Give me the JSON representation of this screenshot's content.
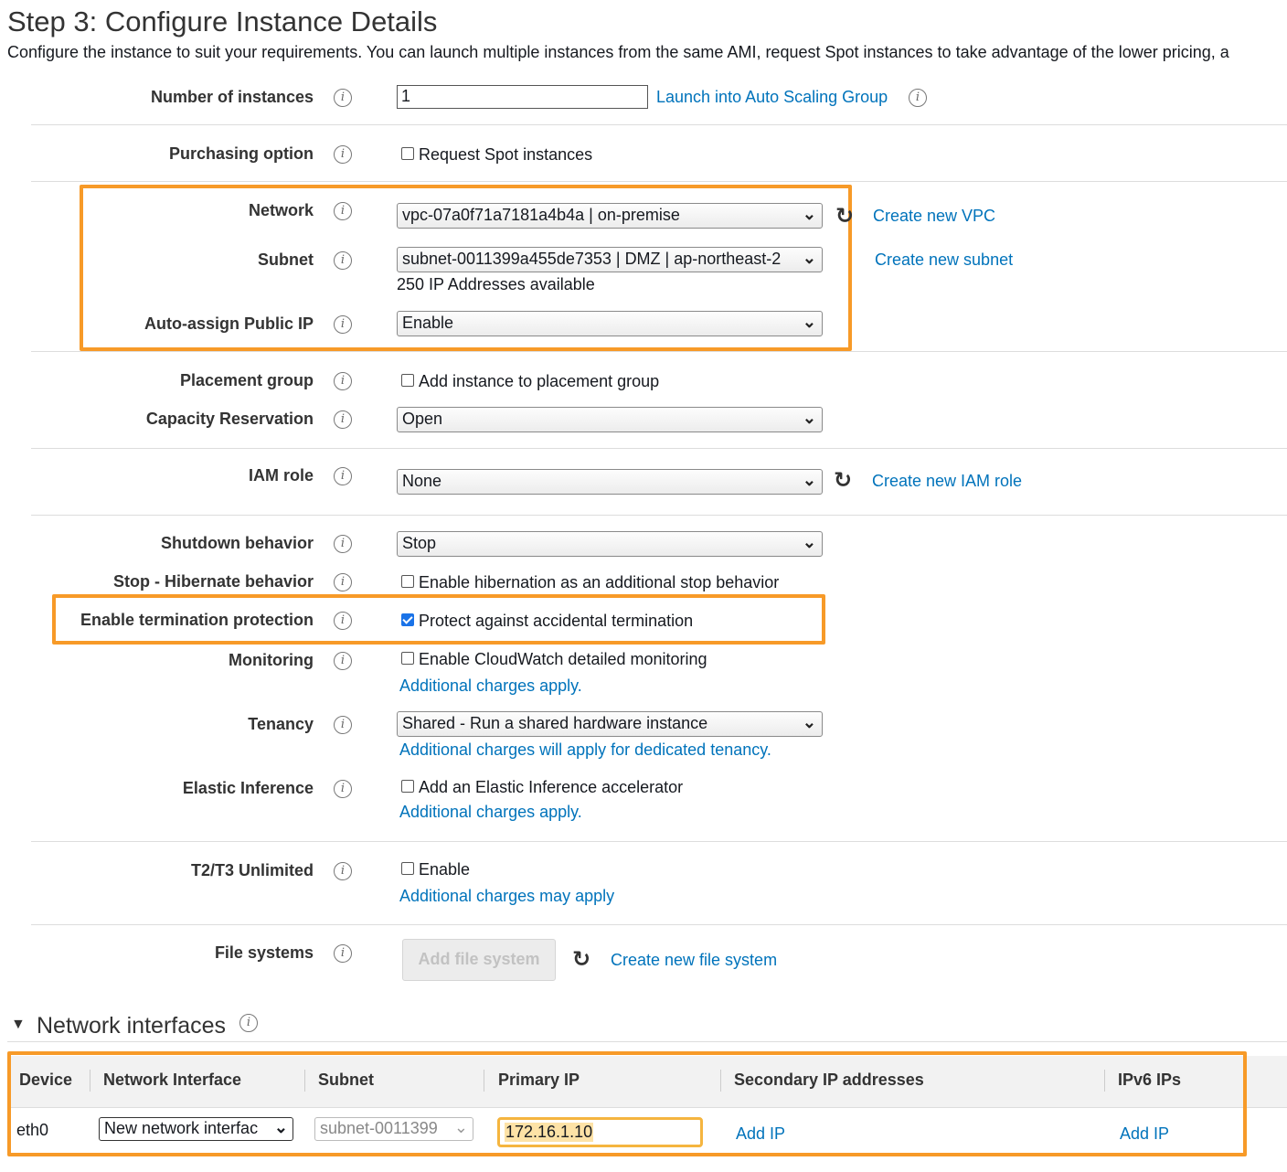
{
  "header": {
    "title": "Step 3: Configure Instance Details",
    "subtitle": "Configure the instance to suit your requirements. You can launch multiple instances from the same AMI, request Spot instances to take advantage of the lower pricing, a"
  },
  "info_glyph": "i",
  "fields": {
    "instances": {
      "label": "Number of instances",
      "value": "1",
      "link": "Launch into Auto Scaling Group"
    },
    "purchasing": {
      "label": "Purchasing option",
      "checkbox": "Request Spot instances",
      "checked": false
    },
    "network": {
      "label": "Network",
      "value": "vpc-07a0f71a7181a4b4a | on-premise",
      "link": "Create new VPC"
    },
    "subnet": {
      "label": "Subnet",
      "value": "subnet-0011399a455de7353 | DMZ | ap-northeast-2",
      "note": "250 IP Addresses available",
      "link": "Create new subnet"
    },
    "public_ip": {
      "label": "Auto-assign Public IP",
      "value": "Enable"
    },
    "placement": {
      "label": "Placement group",
      "checkbox": "Add instance to placement group",
      "checked": false
    },
    "capacity": {
      "label": "Capacity Reservation",
      "value": "Open"
    },
    "iam": {
      "label": "IAM role",
      "value": "None",
      "link": "Create new IAM role"
    },
    "shutdown": {
      "label": "Shutdown behavior",
      "value": "Stop"
    },
    "hibernate": {
      "label": "Stop - Hibernate behavior",
      "checkbox": "Enable hibernation as an additional stop behavior",
      "checked": false
    },
    "termination": {
      "label": "Enable termination protection",
      "checkbox": "Protect against accidental termination",
      "checked": true
    },
    "monitoring": {
      "label": "Monitoring",
      "checkbox": "Enable CloudWatch detailed monitoring",
      "checked": false,
      "link": "Additional charges apply."
    },
    "tenancy": {
      "label": "Tenancy",
      "value": "Shared - Run a shared hardware instance",
      "link": "Additional charges will apply for dedicated tenancy."
    },
    "elastic": {
      "label": "Elastic Inference",
      "checkbox": "Add an Elastic Inference accelerator",
      "checked": false,
      "link": "Additional charges apply."
    },
    "unlimited": {
      "label": "T2/T3 Unlimited",
      "checkbox": "Enable",
      "checked": false,
      "link": "Additional charges may apply"
    },
    "filesystems": {
      "label": "File systems",
      "button": "Add file system",
      "link": "Create new file system"
    }
  },
  "network_interfaces": {
    "title": "Network interfaces",
    "columns": [
      "Device",
      "Network Interface",
      "Subnet",
      "Primary IP",
      "Secondary IP addresses",
      "IPv6 IPs"
    ],
    "row": {
      "device": "eth0",
      "interface": "New network interfac",
      "subnet": "subnet-0011399",
      "primary_ip": "172.16.1.10",
      "secondary": "Add IP",
      "ipv6": "Add IP"
    }
  },
  "colors": {
    "link": "#0073bb",
    "highlight": "#f79a28",
    "checkbox": "#1a73e8"
  }
}
